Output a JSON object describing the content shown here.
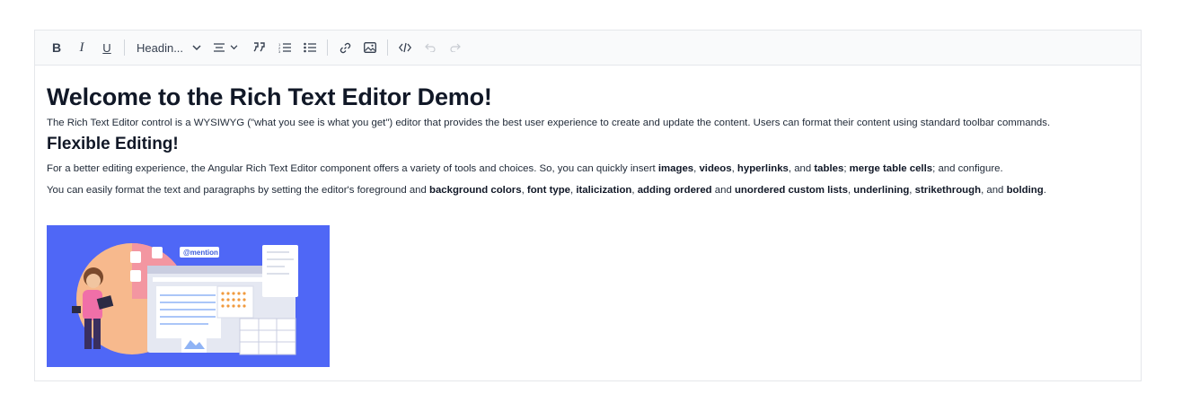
{
  "toolbar": {
    "format_label": "Headin...",
    "buttons": {
      "bold": "B",
      "italic": "I",
      "underline": "U"
    }
  },
  "content": {
    "heading": "Welcome to the Rich Text Editor Demo!",
    "intro": "The Rich Text Editor control is a WYSIWYG (\"what you see is what you get\") editor that provides the best user experience to create and update the content. Users can format their content using standard toolbar commands.",
    "subheading": "Flexible Editing!",
    "para2": {
      "t1": "For a better editing experience, the Angular Rich Text Editor component offers a variety of tools and choices. So, you can quickly insert ",
      "b1": "images",
      "t2": ", ",
      "b2": "videos",
      "t3": ", ",
      "b3": "hyperlinks",
      "t4": ", and ",
      "b4": "tables",
      "t5": "; ",
      "b5": "merge table cells",
      "t6": "; and configure."
    },
    "para3": {
      "t1": "You can easily format the text and paragraphs by setting the editor's foreground and ",
      "b1": "background colors",
      "t2": ", ",
      "b2": "font type",
      "t3": ", ",
      "b3": "italicization",
      "t4": ", ",
      "b4": "adding ordered",
      "t5": " and ",
      "b5": "unordered custom lists",
      "t6": ", ",
      "b6": "underlining",
      "t7": ", ",
      "b7": "strikethrough",
      "t8": ", and ",
      "b8": "bolding",
      "t9": "."
    },
    "image": {
      "mention_badge": "@mention"
    }
  },
  "colors": {
    "image_bg": "#4f67f6",
    "accent": "#3b82f6"
  }
}
